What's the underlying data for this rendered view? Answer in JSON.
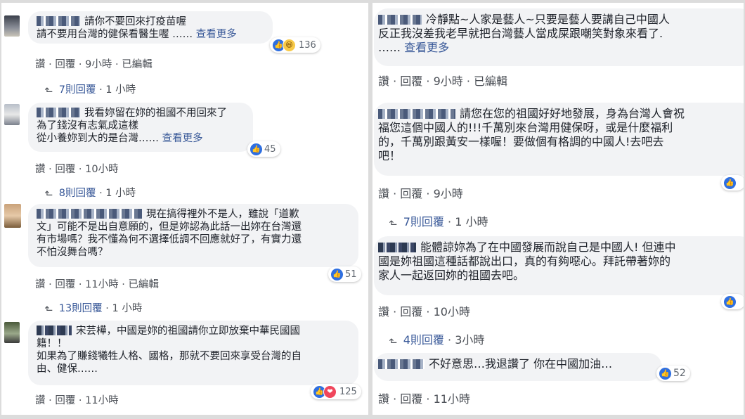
{
  "left": [
    {
      "lines": [
        "請你不要回來打疫苗喔",
        "請不要用台灣的健保看醫生喔 ……"
      ],
      "more": "查看更多",
      "reactions": "136",
      "react_types": [
        "like",
        "haha"
      ],
      "actions": [
        "讚",
        "回覆",
        "9小時",
        "已編輯"
      ],
      "replies": "7則回覆",
      "reply_time": "1 小時"
    },
    {
      "lines": [
        "我看妳留在妳的祖國不用回來了",
        "為了錢沒有志氣成這樣",
        "從小養妳到大的是台灣……"
      ],
      "more": "查看更多",
      "reactions": "45",
      "react_types": [
        "like"
      ],
      "actions": [
        "讚",
        "回覆",
        "10小時"
      ],
      "replies": "8則回覆",
      "reply_time": "1 小時"
    },
    {
      "lines": [
        "現在搞得裡外不是人，雖說「道歉",
        "文」可能不是出自意願的，但是妳認為此話一出妳在台灣還",
        "有市場嗎？我不懂為何不選擇低調不回應就好了，有實力還",
        "不怕沒舞台嗎？"
      ],
      "more": "",
      "reactions": "51",
      "react_types": [
        "like"
      ],
      "actions": [
        "讚",
        "回覆",
        "11小時",
        "已編輯"
      ],
      "replies": "13則回覆",
      "reply_time": "1 小時"
    },
    {
      "lines": [
        "宋芸樺，中國是妳的祖國請你立即放棄中華民國國",
        "籍！！",
        "如果為了賺錢犧牲人格、國格，那就不要回來享受台灣的自",
        "由、健保……"
      ],
      "more": "",
      "reactions": "125",
      "react_types": [
        "like",
        "love"
      ],
      "actions": [
        "讚",
        "回覆",
        "11小時"
      ],
      "replies": "",
      "reply_time": ""
    }
  ],
  "right": [
    {
      "lines": [
        "冷靜點~人家是藝人~只要是藝人要講自己中國人",
        "反正我沒差我老早就把台灣藝人當成屎跟嘲笑對象來看了.",
        "…… "
      ],
      "more": "查看更多",
      "reactions": "",
      "react_types": [],
      "actions": [
        "讚",
        "回覆",
        "9小時",
        "已編輯"
      ],
      "replies": "",
      "reply_time": ""
    },
    {
      "lines": [
        "請您在您的祖國好好地發展，身為台灣人會祝",
        "福您這個中國人的!!!千萬別來台灣用健保呀，或是什麼福利",
        "的，千萬別跟黃安一樣喔！要做個有格調的中國人!去吧去",
        "吧！"
      ],
      "more": "",
      "reactions": "",
      "react_types": [
        "like"
      ],
      "actions": [
        "讚",
        "回覆",
        "9小時"
      ],
      "replies": "7則回覆",
      "reply_time": "1 小時"
    },
    {
      "lines": [
        "能體諒妳為了在中國發展而說自己是中國人! 但連中",
        "國是妳祖國這種話都說出口，真的有夠噁心。拜託帶著妳的",
        "家人一起返回妳的祖國去吧。"
      ],
      "more": "",
      "reactions": "",
      "react_types": [
        "like"
      ],
      "actions": [
        "讚",
        "回覆",
        "10小時"
      ],
      "replies": "4則回覆",
      "reply_time": "3小時"
    },
    {
      "lines": [
        "不好意思…我退讚了 你在中國加油…"
      ],
      "more": "",
      "reactions": "52",
      "react_types": [
        "like"
      ],
      "actions": [
        "讚",
        "回覆",
        "11小時"
      ],
      "replies": "",
      "reply_time": ""
    }
  ],
  "icons": {
    "like": "👍",
    "haha": "😆",
    "love": "❤",
    "reply_arrow": "↳"
  }
}
